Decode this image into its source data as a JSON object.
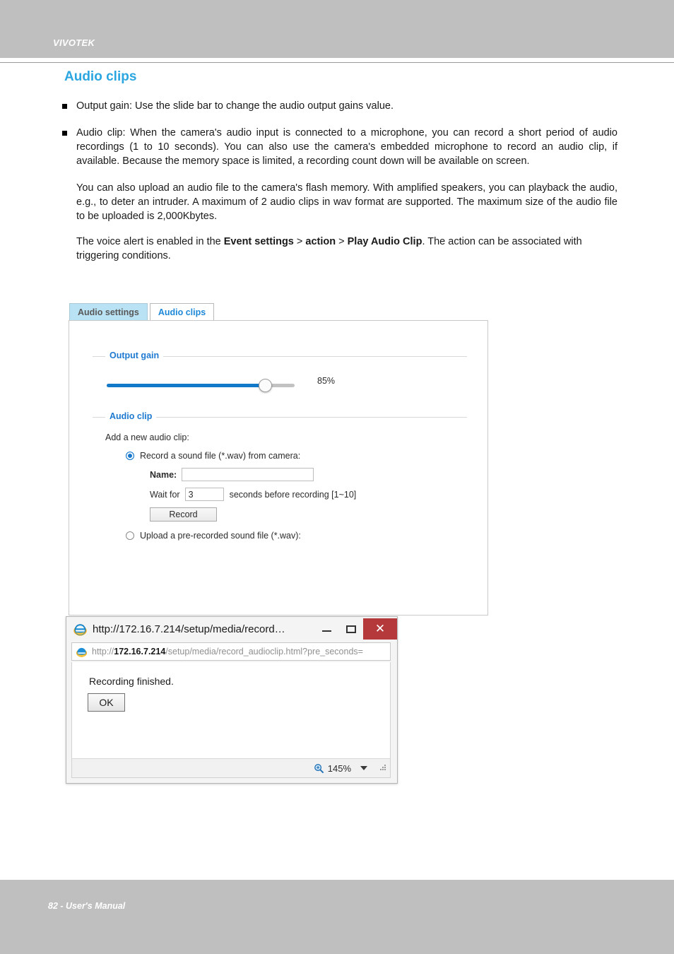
{
  "header": {
    "brand": "VIVOTEK"
  },
  "page": {
    "title": "Audio clips",
    "footer": "82 - User's Manual"
  },
  "body_copy": {
    "bullet1": "Output gain: Use the slide bar to change the audio output gains value.",
    "bullet2": "Audio clip: When the camera's audio input is connected to a microphone, you can record a short period of audio recordings (1 to 10 seconds). You can also use the camera's embedded microphone to record an audio clip, if available. Because the memory space is limited, a recording count down will be available on screen.",
    "para3": "You can also upload an audio file to the camera's flash memory. With amplified speakers, you can playback the audio, e.g., to deter an intruder. A maximum of 2 audio clips in wav format are supported. The maximum size of the audio file to be uploaded is 2,000Kbytes.",
    "para4_pre": "The voice alert is enabled in the ",
    "para4_b1": "Event settings",
    "para4_sep1": " > ",
    "para4_b2": "action",
    "para4_sep2": " > ",
    "para4_b3": "Play Audio Clip",
    "para4_post": ". The action can be associated with triggering conditions."
  },
  "screenshot": {
    "tabs": [
      {
        "label": "Audio settings",
        "active": true
      },
      {
        "label": "Audio clips",
        "active": false
      }
    ],
    "output_gain": {
      "legend": "Output gain",
      "value_label": "85%",
      "percent": 85
    },
    "audio_clip": {
      "legend": "Audio clip",
      "lead": "Add a new audio clip:",
      "option_record": "Record a sound file (*.wav) from camera:",
      "option_upload": "Upload a pre-recorded sound file (*.wav):",
      "name_label": "Name",
      "name_colon": ":",
      "name_value": "",
      "wait_label": "Wait for",
      "wait_value": "3",
      "wait_suffix": "seconds before recording [1~10]",
      "record_button": "Record"
    }
  },
  "ie_dialog": {
    "title": "http://172.16.7.214/setup/media/record…",
    "url_host": "172.16.7.214",
    "url_prefix": "http://",
    "url_path": "/setup/media/record_audioclip.html?pre_seconds=",
    "message": "Recording finished.",
    "ok_label": "OK",
    "zoom_level": "145%",
    "minimize_label": "–",
    "maximize_label": "□",
    "close_label": "✕"
  },
  "colors": {
    "accent_blue": "#2ba6e0",
    "legend_blue": "#1e7ad0",
    "slider_blue": "#1279c8",
    "band_gray": "#bfbfbf",
    "tab_active_bg": "#b9e2f5",
    "close_red": "#b5393b"
  }
}
